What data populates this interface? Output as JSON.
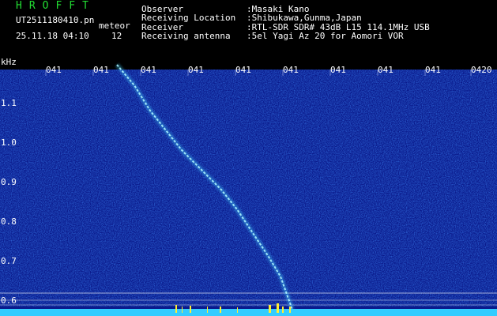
{
  "header": {
    "logo": "HROFFT",
    "file_name": "UT2511180410.pn",
    "mode": "meteor",
    "date_time": "25.11.18 04:10",
    "meteor_count": "12"
  },
  "station_info": [
    {
      "label": "Observer",
      "value": ":Masaki Kano"
    },
    {
      "label": "Receiving Location",
      "value": ":Shibukawa,Gunma,Japan"
    },
    {
      "label": "Receiver",
      "value": ":RTL-SDR SDR# 43dB L15 114.1MHz USB"
    },
    {
      "label": "Receiving antenna",
      "value": ":5el Yagi Az 20 for Aomori VOR"
    }
  ],
  "spectrogram": {
    "y_unit": "kHz",
    "y_ticks": [
      "1.1",
      "1.0",
      "0.9",
      "0.8",
      "0.7",
      "0.6"
    ],
    "time_ticks": [
      "041",
      "041",
      "041",
      "041",
      "041",
      "041",
      "041",
      "041",
      "041",
      "0420"
    ],
    "colors": {
      "background": "#0a1a8c",
      "trail": "#7fe8ff",
      "baseline": "#33ccff",
      "markers": "#ffee33"
    }
  }
}
